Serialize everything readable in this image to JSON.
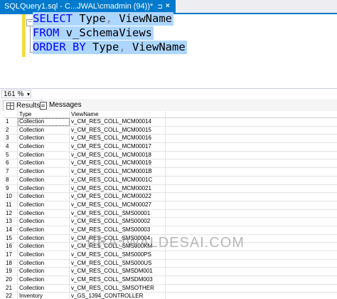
{
  "document_tab": {
    "title": "SQLQuery1.sql - C...JWAL\\cmadmin (94))*",
    "pin_glyph": "⊐",
    "close_glyph": "×"
  },
  "editor": {
    "lines": [
      {
        "tokens": [
          {
            "text": "SELECT ",
            "kind": "kw"
          },
          {
            "text": "Type",
            "kind": "id"
          },
          {
            "text": ", ",
            "kind": "pun"
          },
          {
            "text": "ViewName",
            "kind": "id"
          }
        ]
      },
      {
        "tokens": [
          {
            "text": "FROM ",
            "kind": "kw"
          },
          {
            "text": "v_SchemaViews",
            "kind": "id"
          }
        ]
      },
      {
        "tokens": [
          {
            "text": "ORDER BY ",
            "kind": "kw"
          },
          {
            "text": "Type",
            "kind": "id"
          },
          {
            "text": ", ",
            "kind": "pun"
          },
          {
            "text": "ViewName",
            "kind": "id"
          }
        ]
      }
    ],
    "fold_glyph": "−",
    "selection_color": "#add6ff"
  },
  "zoom": {
    "value": "161 %",
    "arrow": "▾"
  },
  "results_tabs": {
    "results_label": "Results",
    "messages_label": "Messages"
  },
  "grid": {
    "columns": [
      "Type",
      "ViewName"
    ],
    "rows": [
      [
        "1",
        "Collection",
        "v_CM_RES_COLL_MCM00014"
      ],
      [
        "2",
        "Collection",
        "v_CM_RES_COLL_MCM00015"
      ],
      [
        "3",
        "Collection",
        "v_CM_RES_COLL_MCM00016"
      ],
      [
        "4",
        "Collection",
        "v_CM_RES_COLL_MCM00017"
      ],
      [
        "5",
        "Collection",
        "v_CM_RES_COLL_MCM00018"
      ],
      [
        "6",
        "Collection",
        "v_CM_RES_COLL_MCM00019"
      ],
      [
        "7",
        "Collection",
        "v_CM_RES_COLL_MCM0001B"
      ],
      [
        "8",
        "Collection",
        "v_CM_RES_COLL_MCM0001C"
      ],
      [
        "9",
        "Collection",
        "v_CM_RES_COLL_MCM00021"
      ],
      [
        "10",
        "Collection",
        "v_CM_RES_COLL_MCM00022"
      ],
      [
        "11",
        "Collection",
        "v_CM_RES_COLL_MCM00027"
      ],
      [
        "12",
        "Collection",
        "v_CM_RES_COLL_SMS00001"
      ],
      [
        "13",
        "Collection",
        "v_CM_RES_COLL_SMS00002"
      ],
      [
        "14",
        "Collection",
        "v_CM_RES_COLL_SMS00003"
      ],
      [
        "15",
        "Collection",
        "v_CM_RES_COLL_SMS00004"
      ],
      [
        "16",
        "Collection",
        "v_CM_RES_COLL_SMS000KM"
      ],
      [
        "17",
        "Collection",
        "v_CM_RES_COLL_SMS000PS"
      ],
      [
        "18",
        "Collection",
        "v_CM_RES_COLL_SMS000US"
      ],
      [
        "19",
        "Collection",
        "v_CM_RES_COLL_SMSDM001"
      ],
      [
        "20",
        "Collection",
        "v_CM_RES_COLL_SMSDM003"
      ],
      [
        "21",
        "Collection",
        "v_CM_RES_COLL_SMSOTHER"
      ],
      [
        "22",
        "Inventory",
        "v_GS_1394_CONTROLLER"
      ]
    ]
  },
  "watermark": {
    "text": "PRAJWALDESAI.COM"
  },
  "colors": {
    "accent": "#007acc",
    "keyword": "#0000ff",
    "change_bar": "#eede42"
  }
}
